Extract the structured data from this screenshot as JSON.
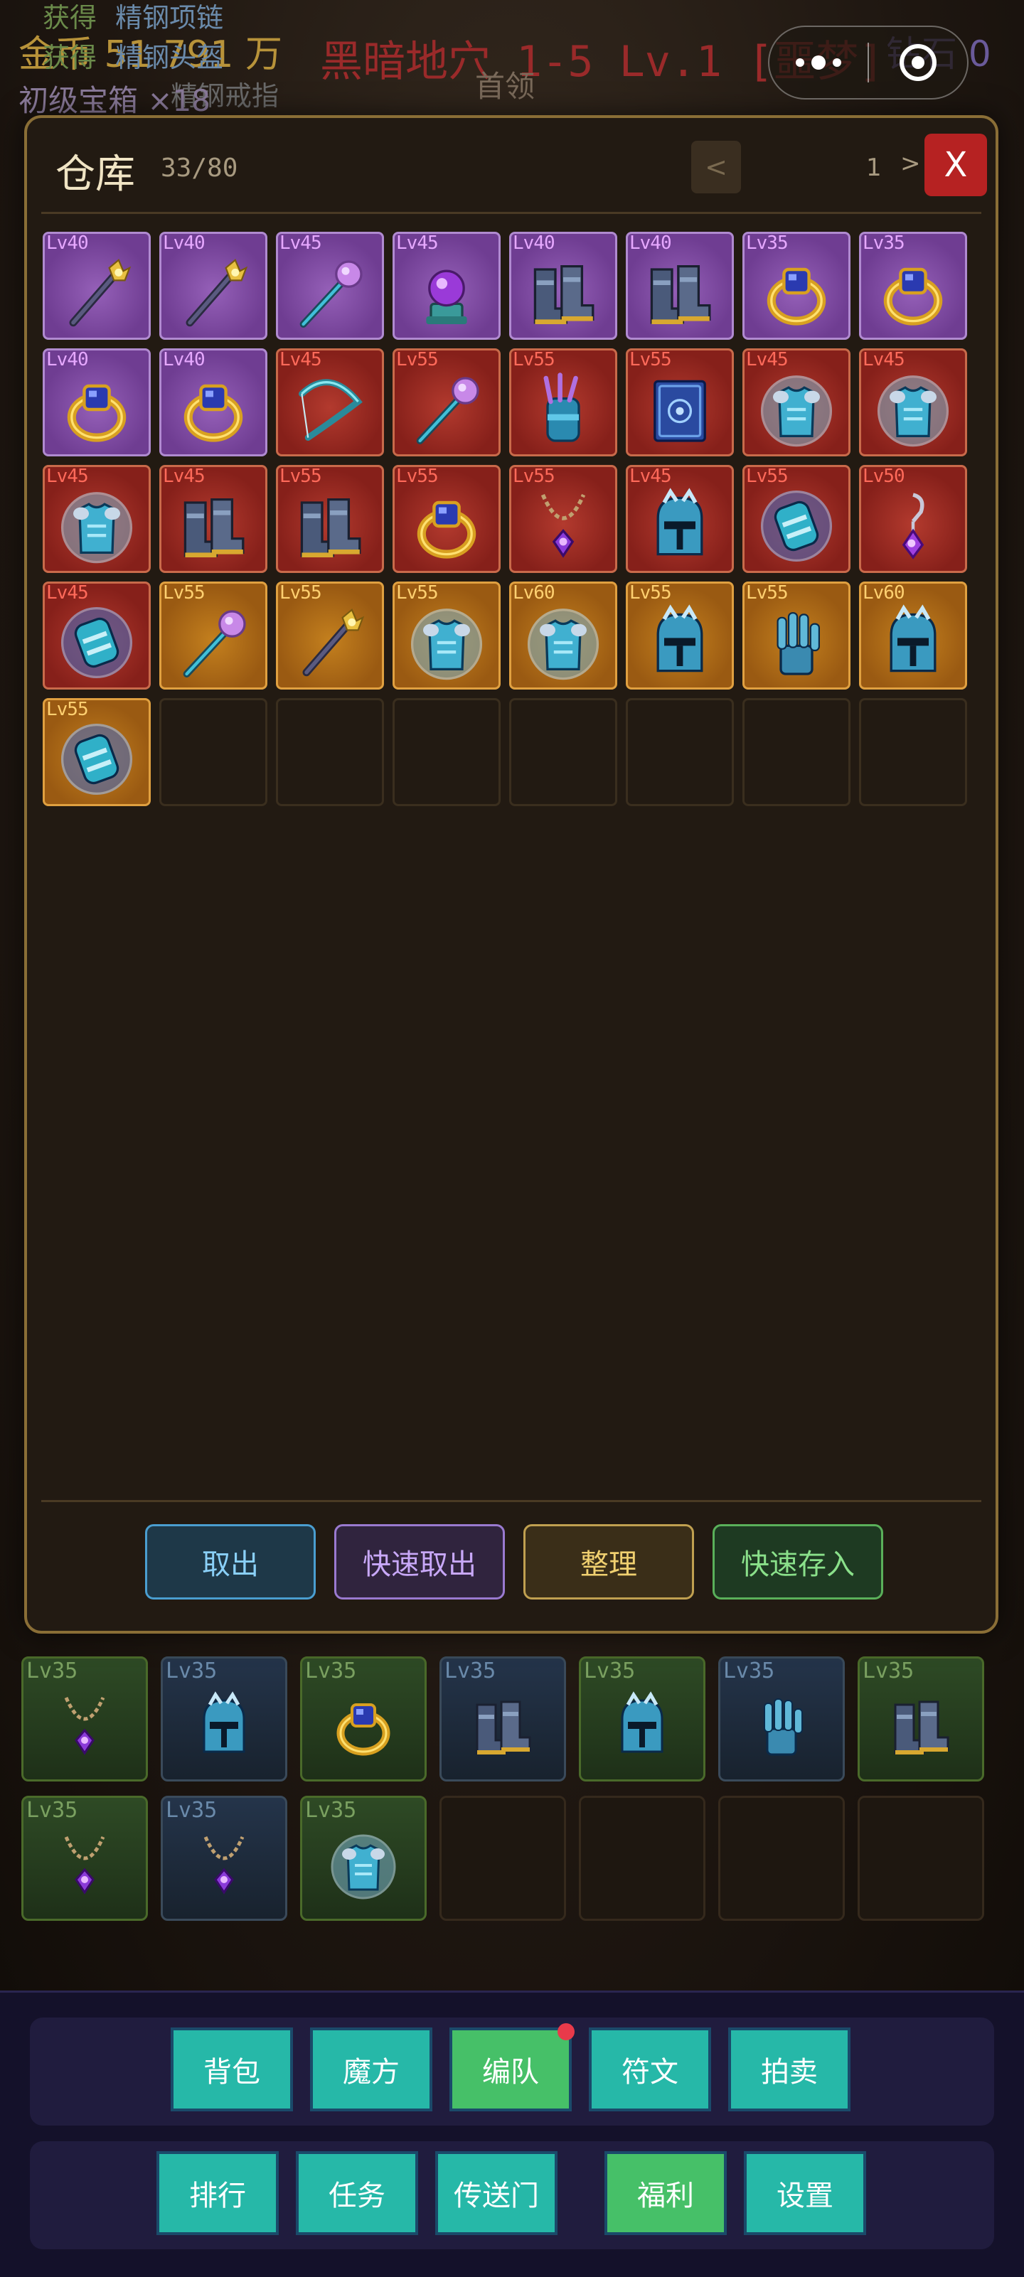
{
  "background": {
    "top_left_text": "金币 51 791 万",
    "stage": "黑暗地穴 1-5 Lv.1 [噩梦]",
    "diamond": "钻石 0",
    "boss_label": "首领",
    "loot_log": [
      {
        "prefix": "获得",
        "item": "精钢项链"
      },
      {
        "prefix": "获得",
        "item": "精钢头盔"
      },
      {
        "prefix": "",
        "item": "精钢戒指"
      }
    ],
    "chest": "初级宝箱 ×18",
    "inventory_rows": [
      [
        {
          "rarity": "green",
          "lv": "Lv35",
          "icon": "necklace-icon"
        },
        {
          "rarity": "blue",
          "lv": "Lv35",
          "icon": "helmet-icon"
        },
        {
          "rarity": "green",
          "lv": "Lv35",
          "icon": "ring-icon"
        },
        {
          "rarity": "blue",
          "lv": "Lv35",
          "icon": "boots-icon"
        },
        {
          "rarity": "green",
          "lv": "Lv35",
          "icon": "helmet-icon"
        },
        {
          "rarity": "blue",
          "lv": "Lv35",
          "icon": "gauntlet-icon"
        },
        {
          "rarity": "green",
          "lv": "Lv35",
          "icon": "boots-icon"
        }
      ],
      [
        {
          "rarity": "green",
          "lv": "Lv35",
          "icon": "necklace-icon"
        },
        {
          "rarity": "blue",
          "lv": "Lv35",
          "icon": "necklace-icon"
        },
        {
          "rarity": "green",
          "lv": "Lv35",
          "icon": "armor-icon"
        },
        {
          "rarity": "empty"
        },
        {
          "rarity": "empty"
        },
        {
          "rarity": "empty"
        },
        {
          "rarity": "empty"
        }
      ]
    ]
  },
  "warehouse": {
    "title": "仓库",
    "count": "33/80",
    "prev_label": "<",
    "next_label": ">",
    "page": "1",
    "close_label": "X",
    "items": [
      {
        "lv": "Lv40",
        "rarity": "purple",
        "icon": "staff-icon"
      },
      {
        "lv": "Lv40",
        "rarity": "purple",
        "icon": "staff-icon"
      },
      {
        "lv": "Lv45",
        "rarity": "purple",
        "icon": "wand-icon"
      },
      {
        "lv": "Lv45",
        "rarity": "purple",
        "icon": "orb-icon"
      },
      {
        "lv": "Lv40",
        "rarity": "purple",
        "icon": "boots-icon"
      },
      {
        "lv": "Lv40",
        "rarity": "purple",
        "icon": "boots-icon"
      },
      {
        "lv": "Lv35",
        "rarity": "purple",
        "icon": "ring-icon"
      },
      {
        "lv": "Lv35",
        "rarity": "purple",
        "icon": "ring-icon"
      },
      {
        "lv": "Lv40",
        "rarity": "purple",
        "icon": "ring-icon"
      },
      {
        "lv": "Lv40",
        "rarity": "purple",
        "icon": "ring-icon"
      },
      {
        "lv": "Lv45",
        "rarity": "red",
        "icon": "bow-icon"
      },
      {
        "lv": "Lv55",
        "rarity": "red",
        "icon": "wand-icon"
      },
      {
        "lv": "Lv55",
        "rarity": "red",
        "icon": "quiver-icon"
      },
      {
        "lv": "Lv55",
        "rarity": "red",
        "icon": "spellbook-icon"
      },
      {
        "lv": "Lv45",
        "rarity": "red",
        "icon": "armor-icon"
      },
      {
        "lv": "Lv45",
        "rarity": "red",
        "icon": "armor-icon"
      },
      {
        "lv": "Lv45",
        "rarity": "red",
        "icon": "armor-icon"
      },
      {
        "lv": "Lv45",
        "rarity": "red",
        "icon": "boots-icon"
      },
      {
        "lv": "Lv55",
        "rarity": "red",
        "icon": "boots-icon"
      },
      {
        "lv": "Lv55",
        "rarity": "red",
        "icon": "ring-icon"
      },
      {
        "lv": "Lv55",
        "rarity": "red",
        "icon": "necklace-icon"
      },
      {
        "lv": "Lv45",
        "rarity": "red",
        "icon": "helmet-icon"
      },
      {
        "lv": "Lv55",
        "rarity": "red",
        "icon": "bracer-icon"
      },
      {
        "lv": "Lv50",
        "rarity": "red",
        "icon": "earring-icon"
      },
      {
        "lv": "Lv45",
        "rarity": "red",
        "icon": "bracer-icon"
      },
      {
        "lv": "Lv55",
        "rarity": "orange",
        "icon": "wand-icon"
      },
      {
        "lv": "Lv55",
        "rarity": "orange",
        "icon": "staff-icon"
      },
      {
        "lv": "Lv55",
        "rarity": "orange",
        "icon": "armor-icon"
      },
      {
        "lv": "Lv60",
        "rarity": "orange",
        "icon": "armor-icon"
      },
      {
        "lv": "Lv55",
        "rarity": "orange",
        "icon": "helmet-icon"
      },
      {
        "lv": "Lv55",
        "rarity": "orange",
        "icon": "gauntlet-icon"
      },
      {
        "lv": "Lv60",
        "rarity": "orange",
        "icon": "helmet-icon"
      },
      {
        "lv": "Lv55",
        "rarity": "orange",
        "icon": "bracer-icon"
      }
    ],
    "total_slots": 40,
    "buttons": {
      "take": "取出",
      "quick_take": "快速取出",
      "sort": "整理",
      "quick_store": "快速存入"
    }
  },
  "miniprogram": {
    "more_icon": "more-dots-icon",
    "close_icon": "target-close-icon"
  },
  "bottom_nav": {
    "row1": [
      {
        "label": "背包",
        "color": "teal",
        "badge": false
      },
      {
        "label": "魔方",
        "color": "teal",
        "badge": false
      },
      {
        "label": "编队",
        "color": "green",
        "badge": true
      },
      {
        "label": "符文",
        "color": "teal",
        "badge": false
      },
      {
        "label": "拍卖",
        "color": "teal",
        "badge": false
      }
    ],
    "row2": [
      {
        "label": "排行",
        "color": "teal",
        "badge": false
      },
      {
        "label": "任务",
        "color": "teal",
        "badge": false
      },
      {
        "label": "传送门",
        "color": "teal",
        "badge": false
      },
      {
        "label": "福利",
        "color": "green",
        "badge": false
      },
      {
        "label": "设置",
        "color": "teal",
        "badge": false
      }
    ]
  },
  "colors": {
    "purple": "#6f3d92",
    "red": "#86201a",
    "orange": "#9a5a12",
    "teal": "#26b8a8",
    "green": "#46c068",
    "gold_border": "#8a6e36"
  }
}
